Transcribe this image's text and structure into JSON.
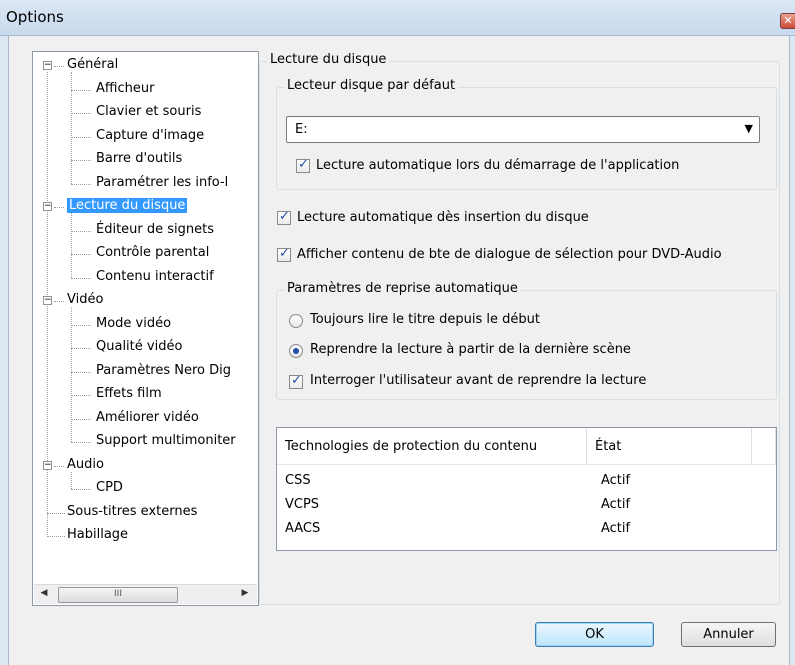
{
  "window": {
    "title": "Options",
    "close_glyph": "✕"
  },
  "tree": {
    "items": [
      {
        "label": "Général",
        "level": 0,
        "expander": "−"
      },
      {
        "label": "Afficheur",
        "level": 1
      },
      {
        "label": "Clavier et souris",
        "level": 1
      },
      {
        "label": "Capture d'image",
        "level": 1
      },
      {
        "label": "Barre d'outils",
        "level": 1
      },
      {
        "label": "Paramétrer les info-l",
        "level": 1
      },
      {
        "label": "Lecture du disque",
        "level": 0,
        "expander": "−",
        "selected": true
      },
      {
        "label": "Éditeur de signets",
        "level": 1
      },
      {
        "label": "Contrôle parental",
        "level": 1
      },
      {
        "label": "Contenu interactif",
        "level": 1
      },
      {
        "label": "Vidéo",
        "level": 0,
        "expander": "−"
      },
      {
        "label": "Mode vidéo",
        "level": 1
      },
      {
        "label": "Qualité vidéo",
        "level": 1
      },
      {
        "label": "Paramètres Nero Dig",
        "level": 1
      },
      {
        "label": "Effets film",
        "level": 1
      },
      {
        "label": "Améliorer vidéo",
        "level": 1
      },
      {
        "label": "Support multimoniter",
        "level": 1
      },
      {
        "label": "Audio",
        "level": 0,
        "expander": "−"
      },
      {
        "label": "CPD",
        "level": 1
      },
      {
        "label": "Sous-titres externes",
        "level": 0
      },
      {
        "label": "Habillage",
        "level": 0
      }
    ],
    "scroll_left": "◀",
    "scroll_right": "▶",
    "scroll_grip": "III"
  },
  "disc": {
    "section_title": "Lecture du disque",
    "default_drive": {
      "title": "Lecteur disque par défaut",
      "selected": "E:",
      "arrow": "▼",
      "autoplay_on_start_label": "Lecture automatique lors du démarrage de l'application",
      "autoplay_on_start": true
    },
    "autoplay_on_insert_label": "Lecture automatique dès insertion du disque",
    "autoplay_on_insert": true,
    "dvd_audio_dialog_label": "Afficher contenu de bte de dialogue de sélection pour DVD-Audio",
    "dvd_audio_dialog": true,
    "resume": {
      "title": "Paramètres de reprise automatique",
      "option_start_label": "Toujours lire le titre depuis le début",
      "option_last_scene_label": "Reprendre la lecture à partir de la dernière scène",
      "selected": "last_scene",
      "ask_user_label": "Interroger l'utilisateur avant de reprendre la lecture",
      "ask_user": true
    },
    "protection_table": {
      "columns": [
        "Technologies de protection du contenu",
        "État"
      ],
      "rows": [
        [
          "CSS",
          "Actif"
        ],
        [
          "VCPS",
          "Actif"
        ],
        [
          "AACS",
          "Actif"
        ]
      ]
    }
  },
  "buttons": {
    "ok": "OK",
    "cancel": "Annuler"
  },
  "colors": {
    "selection": "#3399ff",
    "check": "#1f4ea8"
  },
  "glyphs": {
    "check": "✓"
  }
}
